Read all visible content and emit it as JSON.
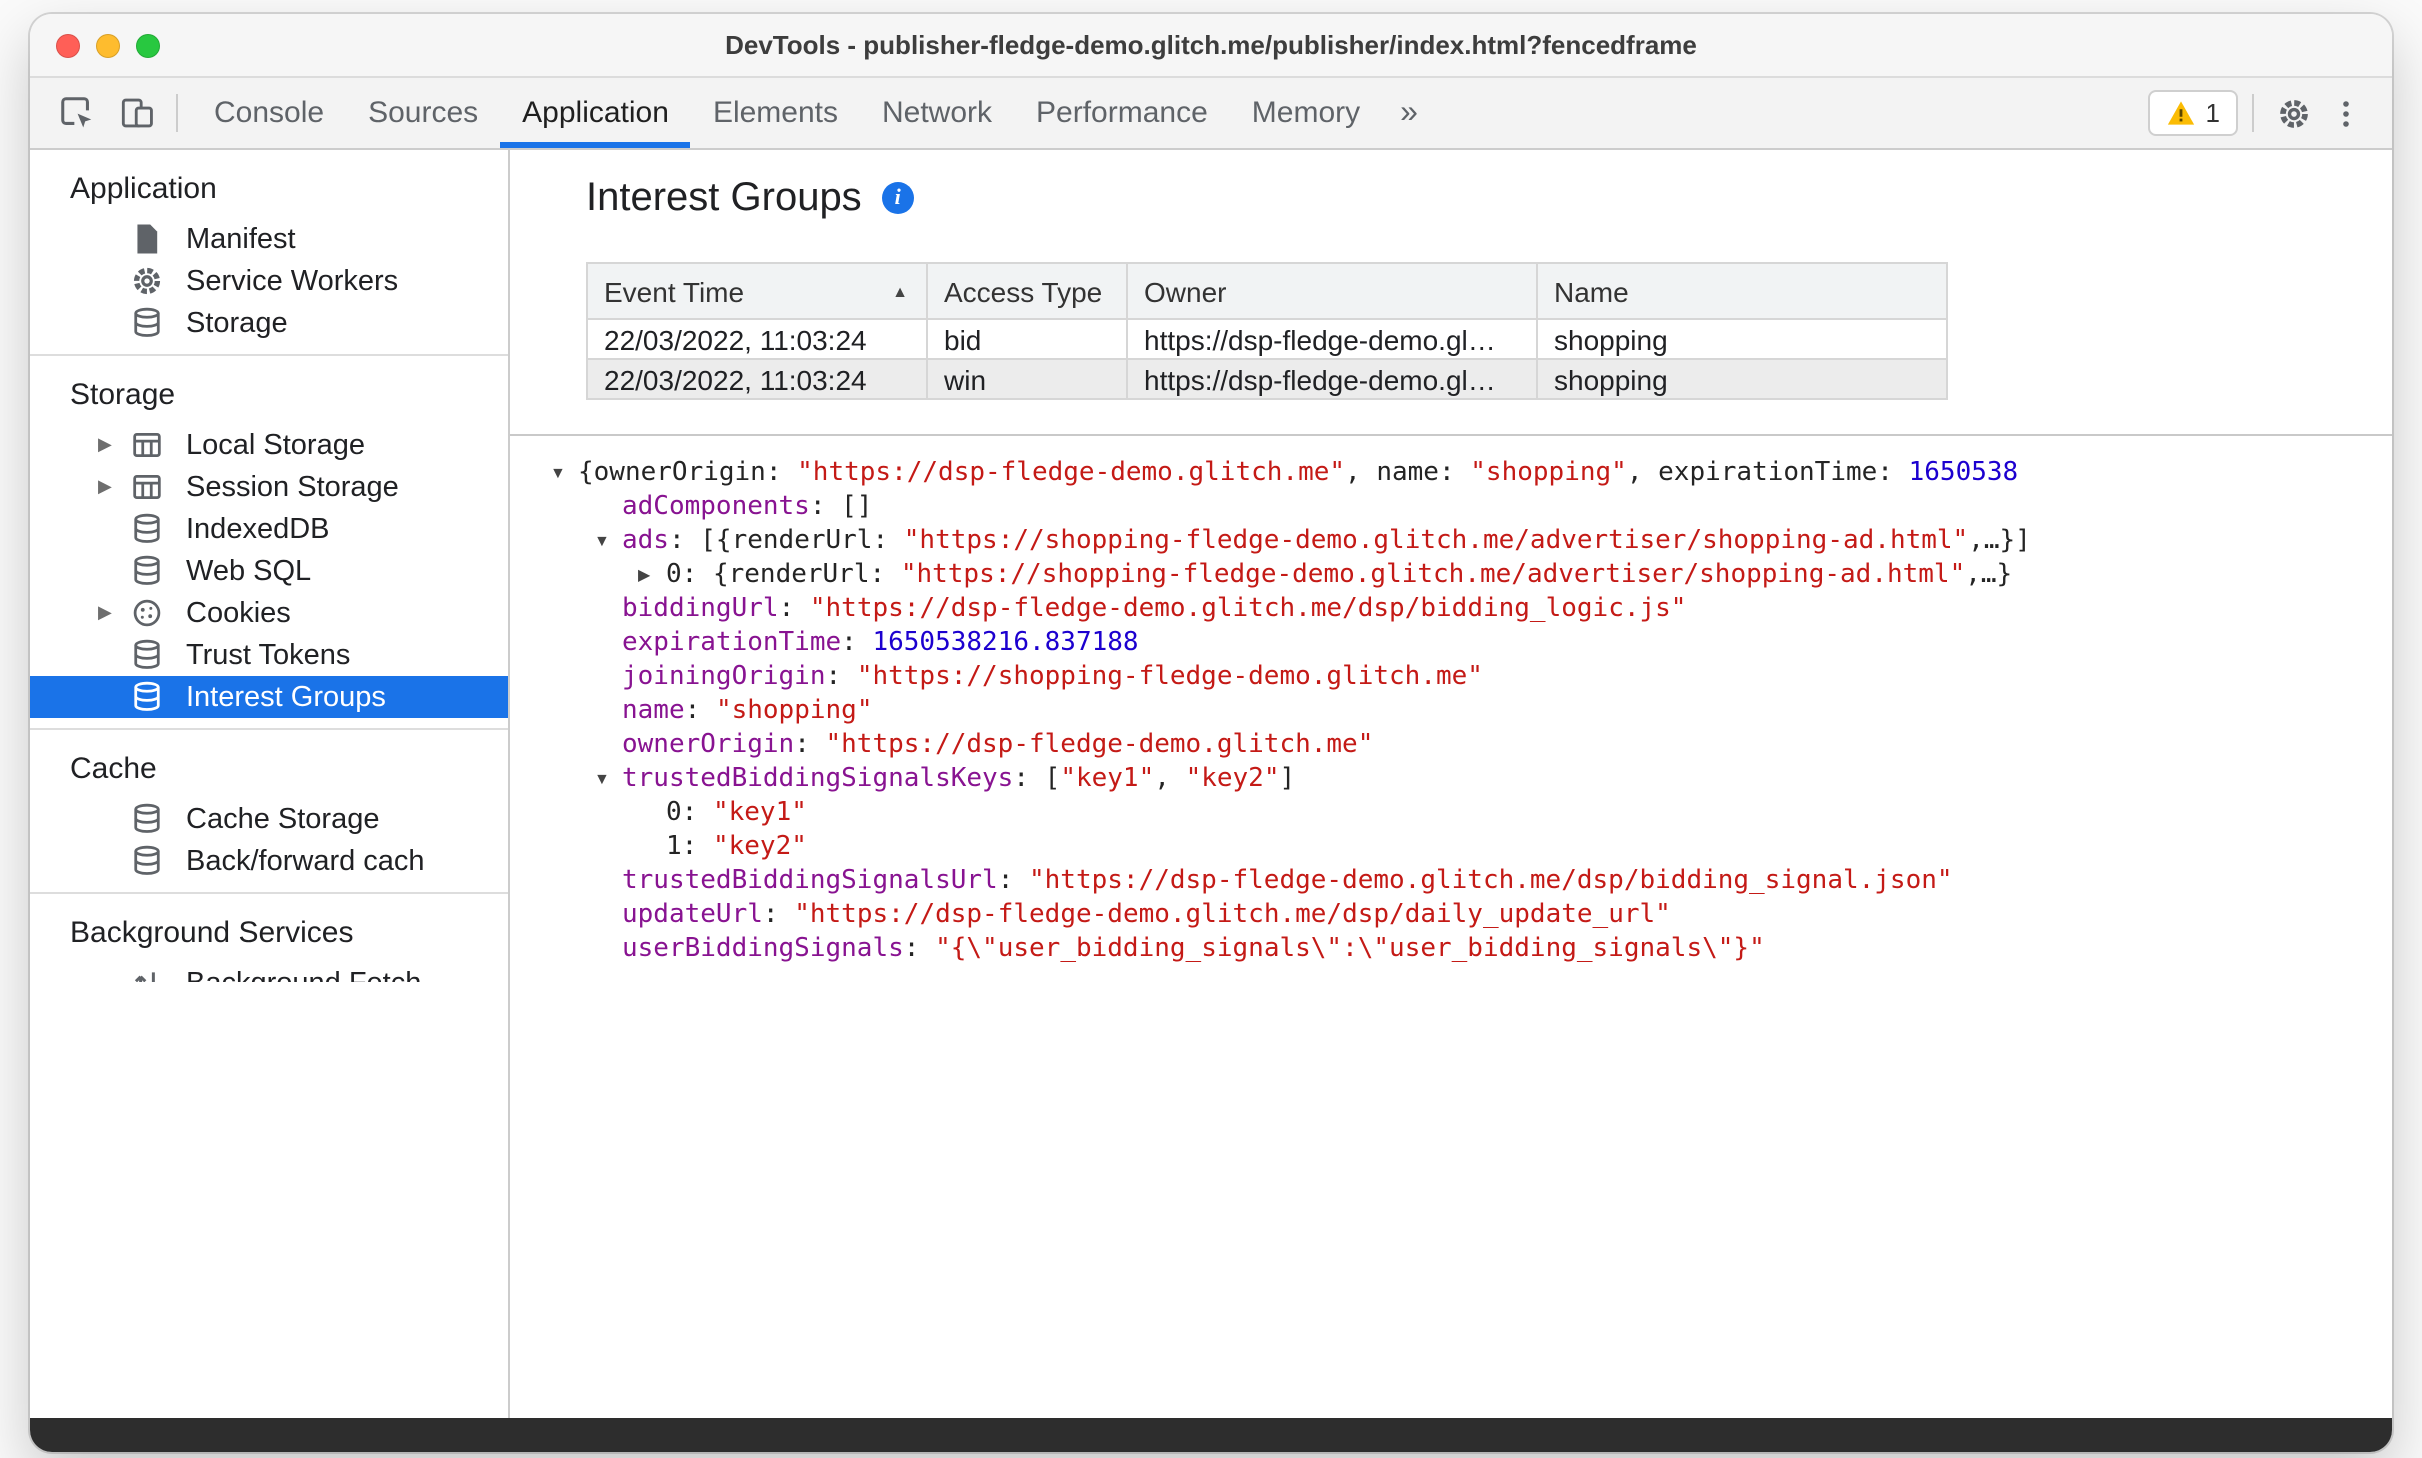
{
  "window": {
    "title": "DevTools - publisher-fledge-demo.glitch.me/publisher/index.html?fencedframe"
  },
  "toolbar": {
    "tabs": [
      {
        "label": "Console",
        "active": false
      },
      {
        "label": "Sources",
        "active": false
      },
      {
        "label": "Application",
        "active": true
      },
      {
        "label": "Elements",
        "active": false
      },
      {
        "label": "Network",
        "active": false
      },
      {
        "label": "Performance",
        "active": false
      },
      {
        "label": "Memory",
        "active": false
      }
    ],
    "overflow_chevron": "»",
    "warning_badge": "1"
  },
  "sidebar": {
    "sections": [
      {
        "title": "Application",
        "items": [
          {
            "label": "Manifest",
            "icon": "file-icon",
            "expandable": false,
            "selected": false
          },
          {
            "label": "Service Workers",
            "icon": "gear-icon",
            "expandable": false,
            "selected": false
          },
          {
            "label": "Storage",
            "icon": "database-icon",
            "expandable": false,
            "selected": false
          }
        ]
      },
      {
        "title": "Storage",
        "items": [
          {
            "label": "Local Storage",
            "icon": "table-icon",
            "expandable": true,
            "selected": false
          },
          {
            "label": "Session Storage",
            "icon": "table-icon",
            "expandable": true,
            "selected": false
          },
          {
            "label": "IndexedDB",
            "icon": "database-icon",
            "expandable": false,
            "selected": false
          },
          {
            "label": "Web SQL",
            "icon": "database-icon",
            "expandable": false,
            "selected": false
          },
          {
            "label": "Cookies",
            "icon": "cookie-icon",
            "expandable": true,
            "selected": false
          },
          {
            "label": "Trust Tokens",
            "icon": "database-icon",
            "expandable": false,
            "selected": false
          },
          {
            "label": "Interest Groups",
            "icon": "database-icon",
            "expandable": false,
            "selected": true
          }
        ]
      },
      {
        "title": "Cache",
        "items": [
          {
            "label": "Cache Storage",
            "icon": "database-icon",
            "expandable": false,
            "selected": false
          },
          {
            "label": "Back/forward cach",
            "icon": "database-icon",
            "expandable": false,
            "selected": false
          }
        ]
      },
      {
        "title": "Background Services",
        "items": [
          {
            "label": "Background Fetch",
            "icon": "fetch-icon",
            "expandable": false,
            "selected": false
          }
        ]
      }
    ]
  },
  "main": {
    "title": "Interest Groups",
    "info_icon": "i",
    "table": {
      "columns": [
        {
          "label": "Event Time",
          "sort": "asc"
        },
        {
          "label": "Access Type",
          "sort": ""
        },
        {
          "label": "Owner",
          "sort": ""
        },
        {
          "label": "Name",
          "sort": ""
        }
      ],
      "rows": [
        {
          "selected": false,
          "cells": [
            "22/03/2022, 11:03:24",
            "bid",
            "https://dsp-fledge-demo.gl…",
            "shopping"
          ]
        },
        {
          "selected": true,
          "cells": [
            "22/03/2022, 11:03:24",
            "win",
            "https://dsp-fledge-demo.gl…",
            "shopping"
          ]
        }
      ]
    },
    "tree": [
      {
        "indent": 0,
        "arrow": "down",
        "segments": [
          {
            "c": "plain",
            "t": "{ownerOrigin: "
          },
          {
            "c": "str",
            "t": "\"https://dsp-fledge-demo.glitch.me\""
          },
          {
            "c": "plain",
            "t": ", name: "
          },
          {
            "c": "str",
            "t": "\"shopping\""
          },
          {
            "c": "plain",
            "t": ", expirationTime: "
          },
          {
            "c": "num",
            "t": "1650538"
          }
        ]
      },
      {
        "indent": 1,
        "arrow": "none",
        "segments": [
          {
            "c": "key",
            "t": "adComponents"
          },
          {
            "c": "plain",
            "t": ": []"
          }
        ]
      },
      {
        "indent": 1,
        "arrow": "down",
        "segments": [
          {
            "c": "key",
            "t": "ads"
          },
          {
            "c": "plain",
            "t": ": [{renderUrl: "
          },
          {
            "c": "str",
            "t": "\"https://shopping-fledge-demo.glitch.me/advertiser/shopping-ad.html\""
          },
          {
            "c": "plain",
            "t": ",…}]"
          }
        ]
      },
      {
        "indent": 2,
        "arrow": "right",
        "segments": [
          {
            "c": "plain",
            "t": "0: {renderUrl: "
          },
          {
            "c": "str",
            "t": "\"https://shopping-fledge-demo.glitch.me/advertiser/shopping-ad.html\""
          },
          {
            "c": "plain",
            "t": ",…}"
          }
        ]
      },
      {
        "indent": 1,
        "arrow": "none",
        "segments": [
          {
            "c": "key",
            "t": "biddingUrl"
          },
          {
            "c": "plain",
            "t": ": "
          },
          {
            "c": "str",
            "t": "\"https://dsp-fledge-demo.glitch.me/dsp/bidding_logic.js\""
          }
        ]
      },
      {
        "indent": 1,
        "arrow": "none",
        "segments": [
          {
            "c": "key",
            "t": "expirationTime"
          },
          {
            "c": "plain",
            "t": ": "
          },
          {
            "c": "num",
            "t": "1650538216.837188"
          }
        ]
      },
      {
        "indent": 1,
        "arrow": "none",
        "segments": [
          {
            "c": "key",
            "t": "joiningOrigin"
          },
          {
            "c": "plain",
            "t": ": "
          },
          {
            "c": "str",
            "t": "\"https://shopping-fledge-demo.glitch.me\""
          }
        ]
      },
      {
        "indent": 1,
        "arrow": "none",
        "segments": [
          {
            "c": "key",
            "t": "name"
          },
          {
            "c": "plain",
            "t": ": "
          },
          {
            "c": "str",
            "t": "\"shopping\""
          }
        ]
      },
      {
        "indent": 1,
        "arrow": "none",
        "segments": [
          {
            "c": "key",
            "t": "ownerOrigin"
          },
          {
            "c": "plain",
            "t": ": "
          },
          {
            "c": "str",
            "t": "\"https://dsp-fledge-demo.glitch.me\""
          }
        ]
      },
      {
        "indent": 1,
        "arrow": "down",
        "segments": [
          {
            "c": "key",
            "t": "trustedBiddingSignalsKeys"
          },
          {
            "c": "plain",
            "t": ": ["
          },
          {
            "c": "str",
            "t": "\"key1\""
          },
          {
            "c": "plain",
            "t": ", "
          },
          {
            "c": "str",
            "t": "\"key2\""
          },
          {
            "c": "plain",
            "t": "]"
          }
        ]
      },
      {
        "indent": 2,
        "arrow": "none",
        "segments": [
          {
            "c": "plain",
            "t": "0: "
          },
          {
            "c": "str",
            "t": "\"key1\""
          }
        ]
      },
      {
        "indent": 2,
        "arrow": "none",
        "segments": [
          {
            "c": "plain",
            "t": "1: "
          },
          {
            "c": "str",
            "t": "\"key2\""
          }
        ]
      },
      {
        "indent": 1,
        "arrow": "none",
        "segments": [
          {
            "c": "key",
            "t": "trustedBiddingSignalsUrl"
          },
          {
            "c": "plain",
            "t": ": "
          },
          {
            "c": "str",
            "t": "\"https://dsp-fledge-demo.glitch.me/dsp/bidding_signal.json\""
          }
        ]
      },
      {
        "indent": 1,
        "arrow": "none",
        "segments": [
          {
            "c": "key",
            "t": "updateUrl"
          },
          {
            "c": "plain",
            "t": ": "
          },
          {
            "c": "str",
            "t": "\"https://dsp-fledge-demo.glitch.me/dsp/daily_update_url\""
          }
        ]
      },
      {
        "indent": 1,
        "arrow": "none",
        "segments": [
          {
            "c": "key",
            "t": "userBiddingSignals"
          },
          {
            "c": "plain",
            "t": ": "
          },
          {
            "c": "str",
            "t": "\"{\\\"user_bidding_signals\\\":\\\"user_bidding_signals\\\"}\""
          }
        ]
      }
    ]
  },
  "colors": {
    "accent_blue": "#1a73e8",
    "selection_blue": "#1a73e8",
    "string_red": "#c41a16",
    "number_blue": "#1c00cf",
    "key_purple": "#881391",
    "warning_yellow": "#fbbc04"
  }
}
